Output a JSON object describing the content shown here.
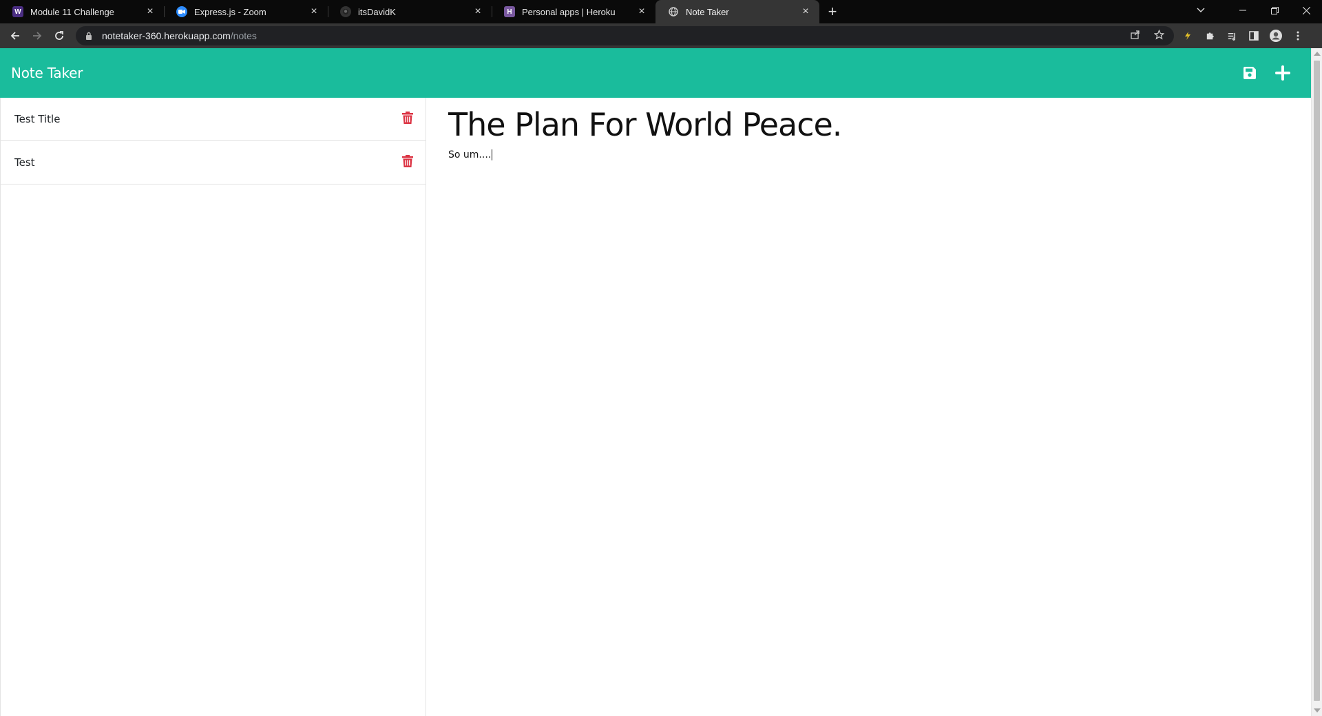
{
  "browser": {
    "tabs": [
      {
        "title": "Module 11 Challenge",
        "favicon": "W",
        "favicon_color": "#4b2e83",
        "active": false
      },
      {
        "title": "Express.js - Zoom",
        "favicon": "zoom",
        "favicon_color": "#2d8cff",
        "active": false
      },
      {
        "title": "itsDavidK",
        "favicon": "github",
        "favicon_color": "#333333",
        "active": false
      },
      {
        "title": "Personal apps | Heroku",
        "favicon": "H",
        "favicon_color": "#79589f",
        "active": false
      },
      {
        "title": "Note Taker",
        "favicon": "globe",
        "favicon_color": "#cccccc",
        "active": true
      }
    ],
    "url_host": "notetaker-360.herokuapp.com",
    "url_path": "/notes"
  },
  "app": {
    "brand": "Note Taker",
    "accent_color": "#1abc9c",
    "notes": [
      {
        "title": "Test Title"
      },
      {
        "title": "Test"
      }
    ],
    "active_note": {
      "title": "The Plan For World Peace.",
      "text": "So um...."
    },
    "delete_icon_color": "#dc3545"
  }
}
